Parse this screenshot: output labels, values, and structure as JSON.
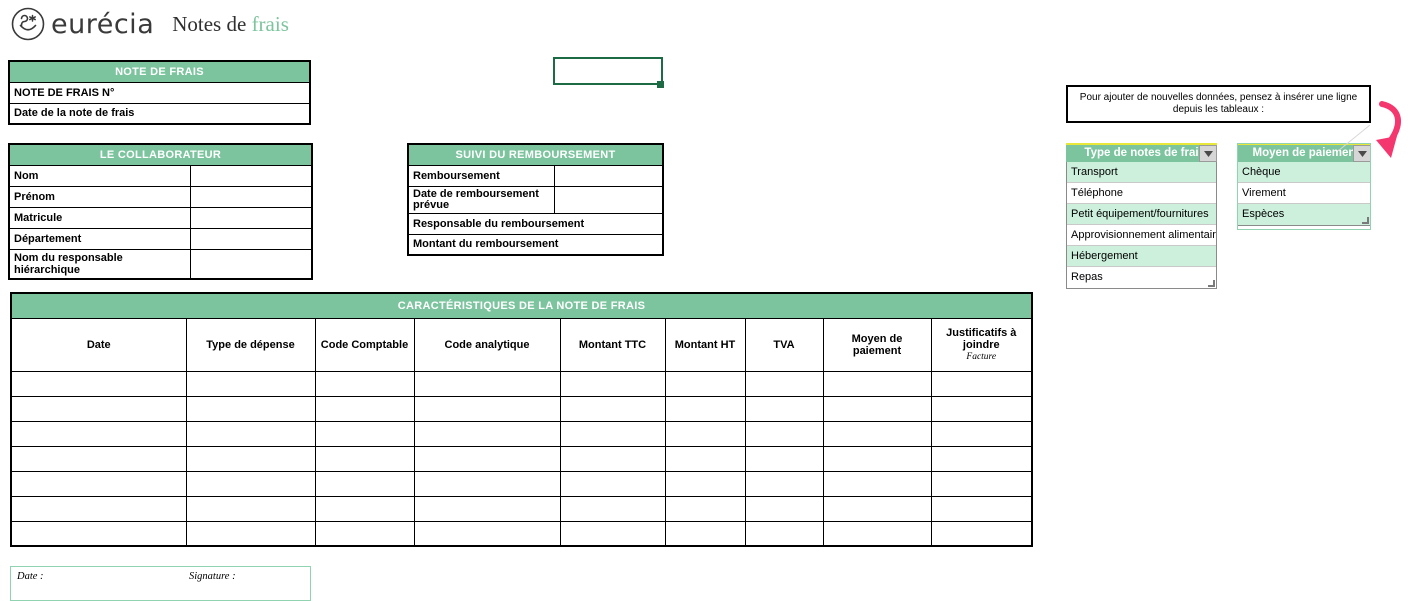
{
  "brand": {
    "logo_icon": "eurecia-smiley-logo",
    "name": "eurécia",
    "doc_title_prefix": "Notes de ",
    "doc_title_accent": "frais",
    "accent_color": "#7cc49e"
  },
  "note_table": {
    "title": "NOTE DE FRAIS",
    "rows": [
      {
        "label": "NOTE DE FRAIS N°",
        "value": ""
      },
      {
        "label": "Date de la note de frais",
        "value": ""
      }
    ]
  },
  "collaborator_table": {
    "title": "LE COLLABORATEUR",
    "rows": [
      {
        "label": "Nom",
        "value": ""
      },
      {
        "label": "Prénom",
        "value": ""
      },
      {
        "label": "Matricule",
        "value": ""
      },
      {
        "label": "Département",
        "value": ""
      },
      {
        "label": "Nom du responsable hiérarchique",
        "value": ""
      }
    ]
  },
  "reimbursement_table": {
    "title": "SUIVI DU REMBOURSEMENT",
    "rows": [
      {
        "label": "Remboursement",
        "value": "",
        "full_width": false
      },
      {
        "label": "Date de remboursement prévue",
        "value": "",
        "full_width": false
      },
      {
        "label": "Responsable du remboursement",
        "value": "",
        "full_width": true
      },
      {
        "label": "Montant du remboursement",
        "value": "",
        "full_width": true
      }
    ]
  },
  "main_table": {
    "title": "CARACTÉRISTIQUES DE LA NOTE DE FRAIS",
    "columns": [
      {
        "label": "Date",
        "sub": ""
      },
      {
        "label": "Type de dépense",
        "sub": ""
      },
      {
        "label": "Code Comptable",
        "sub": ""
      },
      {
        "label": "Code analytique",
        "sub": ""
      },
      {
        "label": "Montant TTC",
        "sub": ""
      },
      {
        "label": "Montant HT",
        "sub": ""
      },
      {
        "label": "TVA",
        "sub": ""
      },
      {
        "label": "Moyen de paiement",
        "sub": ""
      },
      {
        "label": "Justificatifs à joindre",
        "sub": "Facture"
      }
    ],
    "empty_row_count": 7
  },
  "signature_box": {
    "date_label": "Date :",
    "signature_label": "Signature :"
  },
  "info_note": {
    "text": "Pour ajouter de nouvelles données, pensez à insérer une ligne depuis les tableaux :"
  },
  "dropdowns": [
    {
      "header": "Type de notes de frai",
      "full_header": "Type de notes de frais",
      "button_icon": "chevron-down-icon",
      "items": [
        "Transport",
        "Téléphone",
        "Petit équipement/fournitures",
        "Approvisionnement alimentaire",
        "Hébergement",
        "Repas"
      ]
    },
    {
      "header": "Moyen de paiemen",
      "full_header": "Moyen de paiement",
      "button_icon": "chevron-down-icon",
      "items": [
        "Chèque",
        "Virement",
        "Espèces"
      ]
    }
  ],
  "annotation": {
    "arrow_icon": "curved-arrow-down-left",
    "arrow_color": "#f4376e"
  },
  "selected_cell": {
    "value": "",
    "border_color": "#1d6b44"
  }
}
